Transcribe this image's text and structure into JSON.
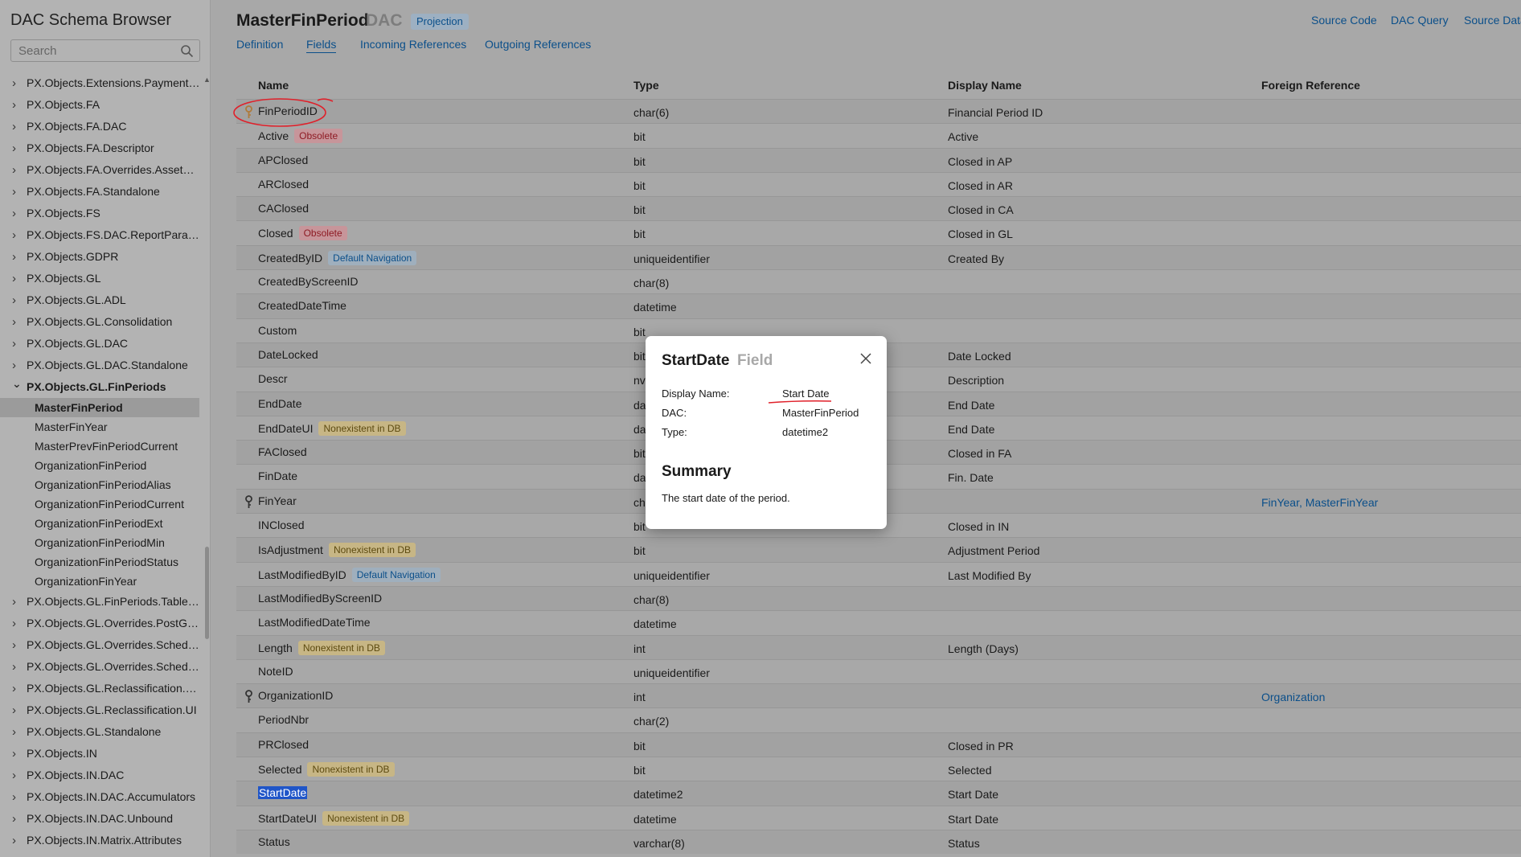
{
  "app": {
    "title": "DAC Schema Browser"
  },
  "search": {
    "placeholder": "Search"
  },
  "sidebar": {
    "items_before": [
      "PX.Objects.Extensions.PaymentTr...",
      "PX.Objects.FA",
      "PX.Objects.FA.DAC",
      "PX.Objects.FA.Descriptor",
      "PX.Objects.FA.Overrides.AssetPro...",
      "PX.Objects.FA.Standalone",
      "PX.Objects.FS",
      "PX.Objects.FS.DAC.ReportParam...",
      "PX.Objects.GDPR",
      "PX.Objects.GL",
      "PX.Objects.GL.ADL",
      "PX.Objects.GL.Consolidation",
      "PX.Objects.GL.DAC",
      "PX.Objects.GL.DAC.Standalone"
    ],
    "expanded": "PX.Objects.GL.FinPeriods",
    "children": [
      "MasterFinPeriod",
      "MasterFinYear",
      "MasterPrevFinPeriodCurrent",
      "OrganizationFinPeriod",
      "OrganizationFinPeriodAlias",
      "OrganizationFinPeriodCurrent",
      "OrganizationFinPeriodExt",
      "OrganizationFinPeriodMin",
      "OrganizationFinPeriodStatus",
      "OrganizationFinYear"
    ],
    "selected_child": "MasterFinPeriod",
    "items_after": [
      "PX.Objects.GL.FinPeriods.TableD...",
      "PX.Objects.GL.Overrides.PostGraph",
      "PX.Objects.GL.Overrides.Schedul...",
      "PX.Objects.GL.Overrides.Schedul...",
      "PX.Objects.GL.Reclassification.Co...",
      "PX.Objects.GL.Reclassification.UI",
      "PX.Objects.GL.Standalone",
      "PX.Objects.IN",
      "PX.Objects.IN.DAC",
      "PX.Objects.IN.DAC.Accumulators",
      "PX.Objects.IN.DAC.Unbound",
      "PX.Objects.IN.Matrix.Attributes"
    ]
  },
  "header": {
    "title": "MasterFinPeriod",
    "subtitle": "DAC",
    "badge": "Projection",
    "links": [
      "Source Code",
      "DAC Query",
      "Source Data"
    ]
  },
  "tabs": [
    "Definition",
    "Fields",
    "Incoming References",
    "Outgoing References"
  ],
  "table": {
    "columns": [
      "Name",
      "Type",
      "Display Name",
      "Foreign Reference"
    ],
    "rows": [
      {
        "name": "FinPeriodID",
        "key": true,
        "key_color": "#b07a3a",
        "tag": "",
        "tag_type": "",
        "type": "char(6)",
        "display": "Financial Period ID",
        "foreign": ""
      },
      {
        "name": "Active",
        "key": false,
        "tag": "Obsolete",
        "tag_type": "obsolete",
        "type": "bit",
        "display": "Active",
        "foreign": ""
      },
      {
        "name": "APClosed",
        "key": false,
        "tag": "",
        "tag_type": "",
        "type": "bit",
        "display": "Closed in AP",
        "foreign": ""
      },
      {
        "name": "ARClosed",
        "key": false,
        "tag": "",
        "tag_type": "",
        "type": "bit",
        "display": "Closed in AR",
        "foreign": ""
      },
      {
        "name": "CAClosed",
        "key": false,
        "tag": "",
        "tag_type": "",
        "type": "bit",
        "display": "Closed in CA",
        "foreign": ""
      },
      {
        "name": "Closed",
        "key": false,
        "tag": "Obsolete",
        "tag_type": "obsolete",
        "type": "bit",
        "display": "Closed in GL",
        "foreign": ""
      },
      {
        "name": "CreatedByID",
        "key": false,
        "tag": "Default Navigation",
        "tag_type": "defnav",
        "type": "uniqueidentifier",
        "display": "Created By",
        "foreign": ""
      },
      {
        "name": "CreatedByScreenID",
        "key": false,
        "tag": "",
        "tag_type": "",
        "type": "char(8)",
        "display": "",
        "foreign": ""
      },
      {
        "name": "CreatedDateTime",
        "key": false,
        "tag": "",
        "tag_type": "",
        "type": "datetime",
        "display": "",
        "foreign": ""
      },
      {
        "name": "Custom",
        "key": false,
        "tag": "",
        "tag_type": "",
        "type": "bit",
        "display": "",
        "foreign": ""
      },
      {
        "name": "DateLocked",
        "key": false,
        "tag": "",
        "tag_type": "",
        "type": "bit",
        "display": "Date Locked",
        "foreign": ""
      },
      {
        "name": "Descr",
        "key": false,
        "tag": "",
        "tag_type": "",
        "type": "nv",
        "display": "Description",
        "foreign": ""
      },
      {
        "name": "EndDate",
        "key": false,
        "tag": "",
        "tag_type": "",
        "type": "da",
        "display": "End Date",
        "foreign": ""
      },
      {
        "name": "EndDateUI",
        "key": false,
        "tag": "Nonexistent in DB",
        "tag_type": "nonexistent",
        "type": "da",
        "display": "End Date",
        "foreign": ""
      },
      {
        "name": "FAClosed",
        "key": false,
        "tag": "",
        "tag_type": "",
        "type": "bit",
        "display": "Closed in FA",
        "foreign": ""
      },
      {
        "name": "FinDate",
        "key": false,
        "tag": "",
        "tag_type": "",
        "type": "da",
        "display": "Fin. Date",
        "foreign": ""
      },
      {
        "name": "FinYear",
        "key": true,
        "key_color": "#333333",
        "tag": "",
        "tag_type": "",
        "type": "ch",
        "display": "",
        "foreign": "FinYear, MasterFinYear"
      },
      {
        "name": "INClosed",
        "key": false,
        "tag": "",
        "tag_type": "",
        "type": "bit",
        "display": "Closed in IN",
        "foreign": ""
      },
      {
        "name": "IsAdjustment",
        "key": false,
        "tag": "Nonexistent in DB",
        "tag_type": "nonexistent",
        "type": "bit",
        "display": "Adjustment Period",
        "foreign": ""
      },
      {
        "name": "LastModifiedByID",
        "key": false,
        "tag": "Default Navigation",
        "tag_type": "defnav",
        "type": "uniqueidentifier",
        "display": "Last Modified By",
        "foreign": ""
      },
      {
        "name": "LastModifiedByScreenID",
        "key": false,
        "tag": "",
        "tag_type": "",
        "type": "char(8)",
        "display": "",
        "foreign": ""
      },
      {
        "name": "LastModifiedDateTime",
        "key": false,
        "tag": "",
        "tag_type": "",
        "type": "datetime",
        "display": "",
        "foreign": ""
      },
      {
        "name": "Length",
        "key": false,
        "tag": "Nonexistent in DB",
        "tag_type": "nonexistent",
        "type": "int",
        "display": "Length (Days)",
        "foreign": ""
      },
      {
        "name": "NoteID",
        "key": false,
        "tag": "",
        "tag_type": "",
        "type": "uniqueidentifier",
        "display": "",
        "foreign": ""
      },
      {
        "name": "OrganizationID",
        "key": true,
        "key_color": "#333333",
        "tag": "",
        "tag_type": "",
        "type": "int",
        "display": "",
        "foreign": "Organization"
      },
      {
        "name": "PeriodNbr",
        "key": false,
        "tag": "",
        "tag_type": "",
        "type": "char(2)",
        "display": "",
        "foreign": ""
      },
      {
        "name": "PRClosed",
        "key": false,
        "tag": "",
        "tag_type": "",
        "type": "bit",
        "display": "Closed in PR",
        "foreign": ""
      },
      {
        "name": "Selected",
        "key": false,
        "tag": "Nonexistent in DB",
        "tag_type": "nonexistent",
        "type": "bit",
        "display": "Selected",
        "foreign": ""
      },
      {
        "name": "StartDate",
        "key": false,
        "selected_text": true,
        "tag": "",
        "tag_type": "",
        "type": "datetime2",
        "display": "Start Date",
        "foreign": ""
      },
      {
        "name": "StartDateUI",
        "key": false,
        "tag": "Nonexistent in DB",
        "tag_type": "nonexistent",
        "type": "datetime",
        "display": "Start Date",
        "foreign": ""
      },
      {
        "name": "Status",
        "key": false,
        "tag": "",
        "tag_type": "",
        "type": "varchar(8)",
        "display": "Status",
        "foreign": ""
      }
    ]
  },
  "modal": {
    "title": "StartDate",
    "subtitle": "Field",
    "fields": [
      {
        "label": "Display Name:",
        "value": "Start Date"
      },
      {
        "label": "DAC:",
        "value": "MasterFinPeriod"
      },
      {
        "label": "Type:",
        "value": "datetime2"
      }
    ],
    "summary_heading": "Summary",
    "summary_text": "The start date of the period."
  },
  "colors": {
    "link": "#0b4f8a",
    "annotation": "#e0202a",
    "selection": "#1f55c8"
  }
}
